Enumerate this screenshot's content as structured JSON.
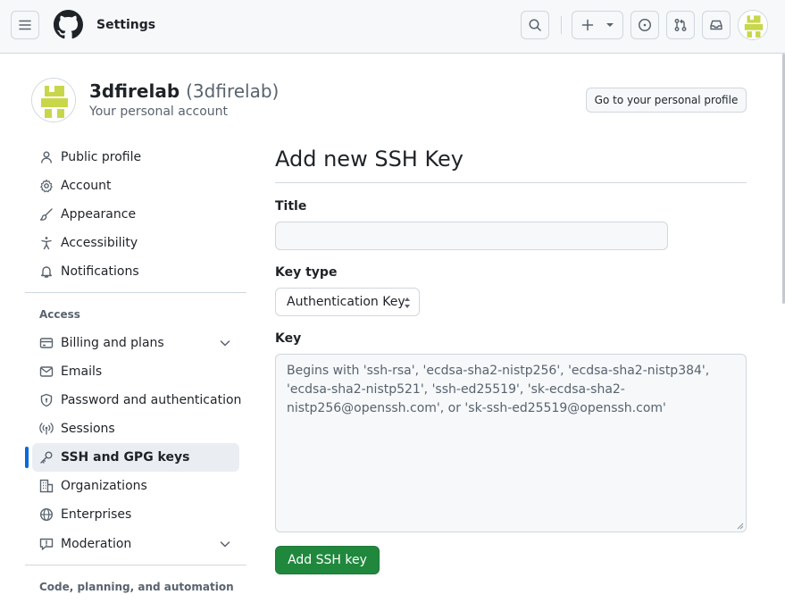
{
  "header": {
    "title": "Settings",
    "icons": [
      "hamburger-icon",
      "github-logo",
      "search-icon",
      "plus-icon",
      "caret-down-icon",
      "issues-icon",
      "pull-request-icon",
      "inbox-icon",
      "avatar"
    ]
  },
  "profile": {
    "name": "3dfirelab",
    "login": "(3dfirelab)",
    "subtitle": "Your personal account",
    "profile_button": "Go to your personal profile"
  },
  "sidebar": {
    "items_top": [
      {
        "label": "Public profile",
        "icon": "person-icon"
      },
      {
        "label": "Account",
        "icon": "gear-icon"
      },
      {
        "label": "Appearance",
        "icon": "paintbrush-icon"
      },
      {
        "label": "Accessibility",
        "icon": "accessibility-icon"
      },
      {
        "label": "Notifications",
        "icon": "bell-icon"
      }
    ],
    "access_heading": "Access",
    "items_access": [
      {
        "label": "Billing and plans",
        "icon": "credit-card-icon",
        "expandable": true
      },
      {
        "label": "Emails",
        "icon": "mail-icon"
      },
      {
        "label": "Password and authentication",
        "icon": "shield-lock-icon"
      },
      {
        "label": "Sessions",
        "icon": "broadcast-icon"
      },
      {
        "label": "SSH and GPG keys",
        "icon": "key-icon",
        "active": true
      },
      {
        "label": "Organizations",
        "icon": "organization-icon"
      },
      {
        "label": "Enterprises",
        "icon": "globe-icon"
      },
      {
        "label": "Moderation",
        "icon": "report-icon",
        "expandable": true
      }
    ],
    "code_heading": "Code, planning, and automation"
  },
  "main": {
    "title": "Add new SSH Key",
    "title_label": "Title",
    "title_value": "",
    "key_type_label": "Key type",
    "key_type_selected": "Authentication Key",
    "key_label": "Key",
    "key_placeholder": "Begins with 'ssh-rsa', 'ecdsa-sha2-nistp256', 'ecdsa-sha2-nistp384', 'ecdsa-sha2-nistp521', 'ssh-ed25519', 'sk-ecdsa-sha2-nistp256@openssh.com', or 'sk-ssh-ed25519@openssh.com'",
    "submit_label": "Add SSH key"
  },
  "colors": {
    "accent": "#0969da",
    "primary_button": "#1f883d",
    "avatar_fill": "#c8d74a",
    "header_bg": "#f6f8fa",
    "border": "#d0d7de"
  }
}
